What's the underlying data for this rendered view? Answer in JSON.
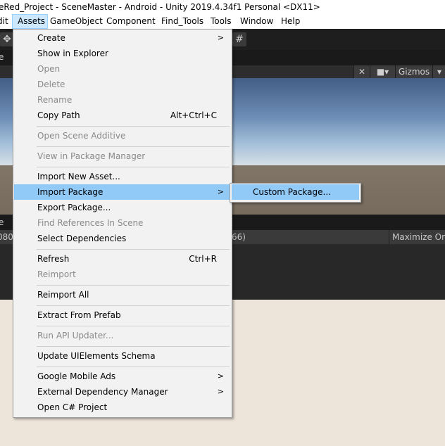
{
  "window": {
    "title": "eRed_Project - SceneMaster - Android - Unity 2019.4.34f1 Personal <DX11>"
  },
  "menubar": {
    "items": [
      "dit",
      "Assets",
      "GameObject",
      "Component",
      "Find_Tools",
      "Tools",
      "Window",
      "Help"
    ]
  },
  "editor": {
    "scene_tab_fragment": "e",
    "scene_view_fragment": "e",
    "gizmos_label": "Gizmos",
    "game_res_fragment": "080",
    "game_scale_fragment": "66)",
    "maximize_label": "Maximize On"
  },
  "assets_menu": {
    "items": [
      {
        "label": "Create",
        "submenu": true
      },
      {
        "label": "Show in Explorer"
      },
      {
        "label": "Open",
        "disabled": true
      },
      {
        "label": "Delete",
        "disabled": true
      },
      {
        "label": "Rename",
        "disabled": true
      },
      {
        "label": "Copy Path",
        "shortcut": "Alt+Ctrl+C"
      },
      {
        "label": "Open Scene Additive",
        "disabled": true
      },
      {
        "label": "View in Package Manager",
        "disabled": true
      },
      {
        "label": "Import New Asset..."
      },
      {
        "label": "Import Package",
        "submenu": true,
        "highlighted": true
      },
      {
        "label": "Export Package..."
      },
      {
        "label": "Find References In Scene",
        "disabled": true
      },
      {
        "label": "Select Dependencies"
      },
      {
        "label": "Refresh",
        "shortcut": "Ctrl+R"
      },
      {
        "label": "Reimport",
        "disabled": true
      },
      {
        "label": "Reimport All"
      },
      {
        "label": "Extract From Prefab"
      },
      {
        "label": "Run API Updater...",
        "disabled": true
      },
      {
        "label": "Update UIElements Schema"
      },
      {
        "label": "Google Mobile Ads",
        "submenu": true
      },
      {
        "label": "External Dependency Manager",
        "submenu": true
      },
      {
        "label": "Open C# Project"
      }
    ]
  },
  "import_package_submenu": {
    "items": [
      {
        "label": "Custom Package...",
        "highlighted": true
      }
    ]
  },
  "colors": {
    "menu_bg": "#f2f2f2",
    "highlight": "#91c9f7",
    "disabled_text": "#8a8a8a",
    "menubar_active": "#cce8ff"
  },
  "icons": {
    "submenu_arrow": "chevron-right-icon",
    "move_tool": "move-tool-icon",
    "tools": "tools-icon",
    "camera": "camera-icon"
  }
}
